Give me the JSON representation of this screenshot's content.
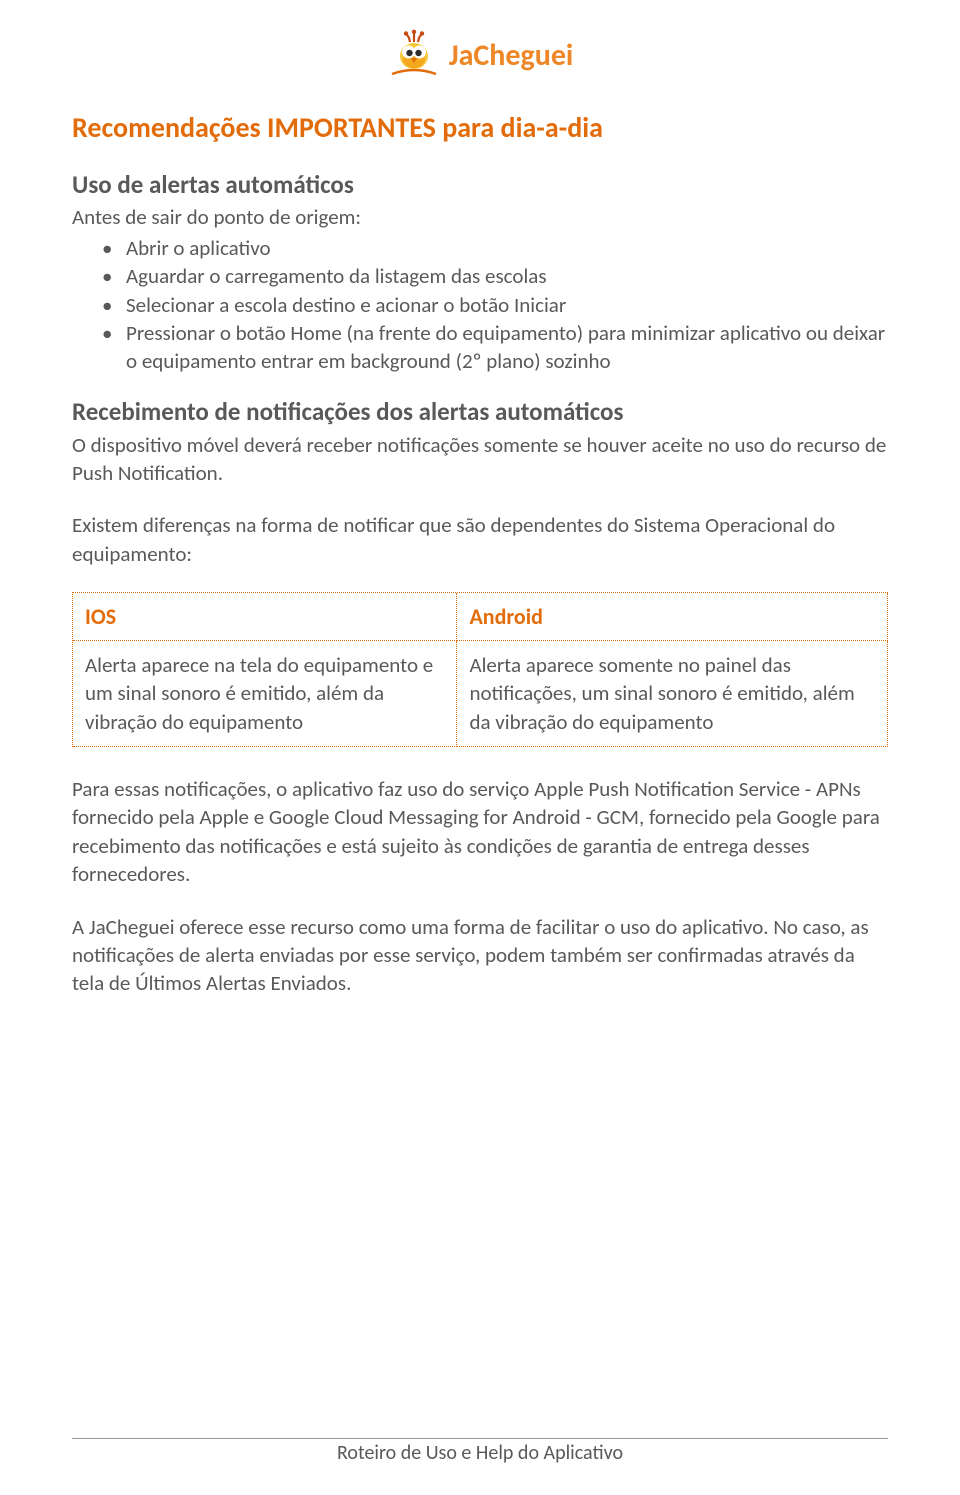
{
  "brand": {
    "name": "JaCheguei"
  },
  "title": "Recomendações IMPORTANTES para dia-a-dia",
  "section1": {
    "heading": "Uso de alertas automáticos",
    "lead": "Antes de sair do ponto de origem:",
    "items": [
      "Abrir o aplicativo",
      "Aguardar o carregamento da listagem das escolas",
      "Selecionar a escola destino e acionar o botão Iniciar",
      "Pressionar o botão Home (na frente do equipamento) para minimizar aplicativo ou deixar o equipamento entrar em background (2º plano) sozinho"
    ]
  },
  "section2": {
    "heading": "Recebimento de notificações dos alertas automáticos",
    "para1": "O dispositivo móvel deverá receber notificações somente se houver aceite no uso do recurso de Push Notification.",
    "para2": "Existem diferenças na forma de notificar que são dependentes do Sistema Operacional do equipamento:"
  },
  "table": {
    "ios_header": "IOS",
    "android_header": "Android",
    "ios_cell": "Alerta aparece na tela do equipamento e um sinal sonoro é emitido, além da vibração do equipamento",
    "android_cell": "Alerta aparece somente no painel das notificações, um sinal sonoro é emitido, além da vibração do equipamento"
  },
  "section3": {
    "para1": "Para essas notificações, o aplicativo faz uso do serviço Apple Push Notification Service - APNs fornecido pela Apple e Google Cloud Messaging for Android - GCM, fornecido pela Google para recebimento das notificações e está sujeito às condições de garantia de entrega desses fornecedores.",
    "para2": "A JaCheguei oferece esse recurso como uma forma de facilitar o uso do aplicativo. No caso, as notificações de alerta enviadas por esse serviço, podem também ser confirmadas através da tela de Últimos Alertas Enviados."
  },
  "footer": "Roteiro de Uso e Help do Aplicativo"
}
